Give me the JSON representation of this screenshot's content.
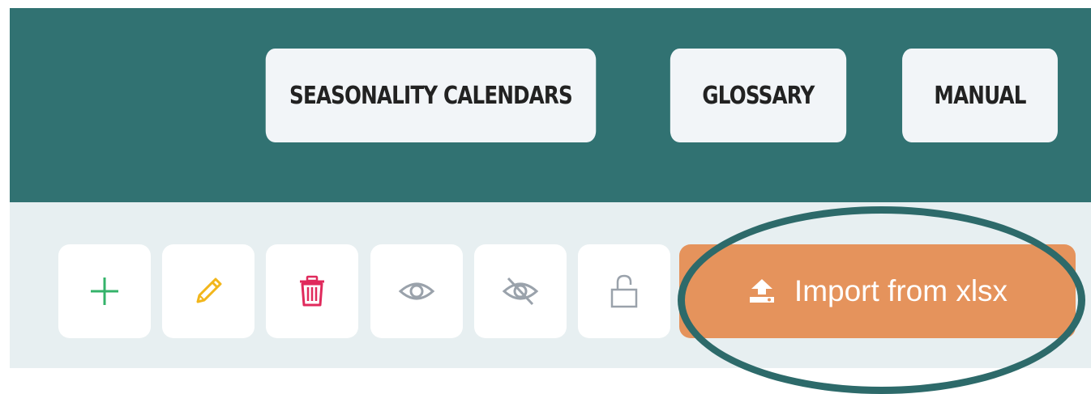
{
  "header": {
    "nav": [
      {
        "label": "SEASONALITY CALENDARS"
      },
      {
        "label": "GLOSSARY"
      },
      {
        "label": "MANUAL"
      }
    ]
  },
  "toolbar": {
    "tools": [
      {
        "name": "add",
        "icon": "plus-icon",
        "color": "#34b36a"
      },
      {
        "name": "edit",
        "icon": "pencil-icon",
        "color": "#f2b61b"
      },
      {
        "name": "delete",
        "icon": "trash-icon",
        "color": "#e02a5c"
      },
      {
        "name": "show",
        "icon": "eye-icon",
        "color": "#9aa2ab"
      },
      {
        "name": "hide",
        "icon": "eye-off-icon",
        "color": "#9aa2ab"
      },
      {
        "name": "unlock",
        "icon": "unlock-icon",
        "color": "#9aa2ab"
      }
    ],
    "import_label": "Import from xlsx",
    "import_color": "#e5935c"
  },
  "colors": {
    "header_bg": "#317272",
    "toolbar_bg": "#e7eff1",
    "highlight": "#2d6a6a"
  }
}
